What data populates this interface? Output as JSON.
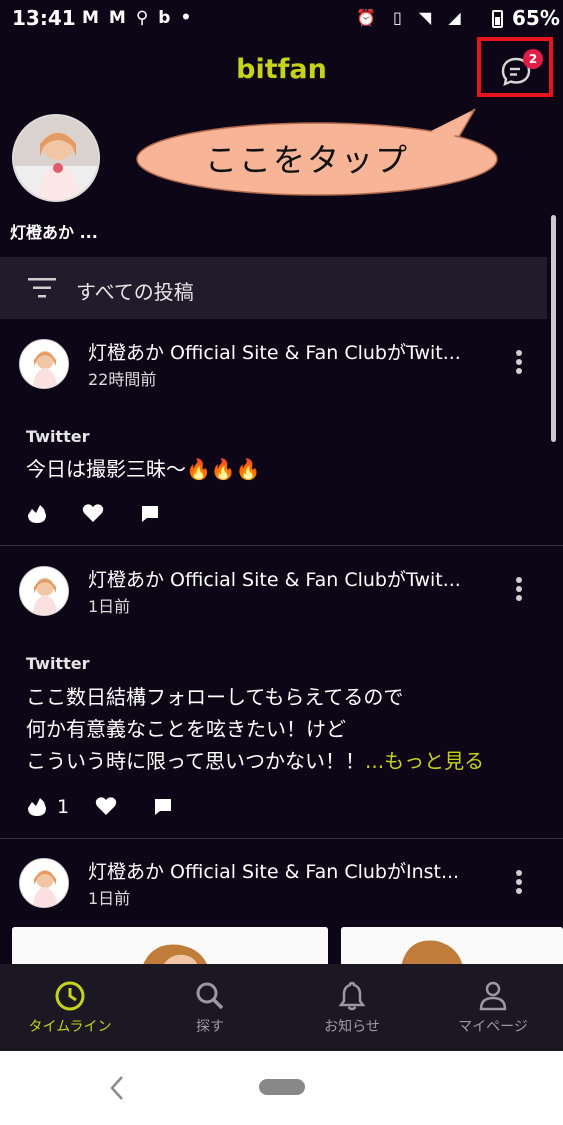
{
  "status_bar": {
    "time": "13:41",
    "notif_icons": "MM🗺ᵇ•",
    "right_icons": "⏰ 📳 ▲ ◢",
    "battery_percent": "65%"
  },
  "header": {
    "logo": "bitfan",
    "chat_badge": "2",
    "accent_color": "#c6d31a",
    "highlight_color": "#e8141b"
  },
  "tooltip": {
    "text": "ここをタップ"
  },
  "story": {
    "name": "灯橙あか ..."
  },
  "filter": {
    "label": "すべての投稿"
  },
  "posts": [
    {
      "title": "灯橙あか Official Site & Fan ClubがTwit...",
      "time": "22時間前",
      "source": "Twitter",
      "body_lines": [
        "今日は撮影三昧〜🔥🔥🔥"
      ],
      "like_count": ""
    },
    {
      "title": "灯橙あか Official Site & Fan ClubがTwit...",
      "time": "1日前",
      "source": "Twitter",
      "body_lines": [
        "ここ数日結構フォローしてもらえてるので",
        "何か有意義なことを呟きたい！けど",
        "こういう時に限って思いつかない！！"
      ],
      "more_link": "...もっと見る",
      "like_count": "1"
    },
    {
      "title": "灯橙あか Official Site & Fan ClubがInst...",
      "time": "1日前"
    }
  ],
  "bottom_nav": [
    {
      "label": "タイムライン",
      "icon": "clock-icon",
      "active": true
    },
    {
      "label": "探す",
      "icon": "search-icon",
      "active": false
    },
    {
      "label": "お知らせ",
      "icon": "bell-icon",
      "active": false
    },
    {
      "label": "マイページ",
      "icon": "person-icon",
      "active": false
    }
  ]
}
